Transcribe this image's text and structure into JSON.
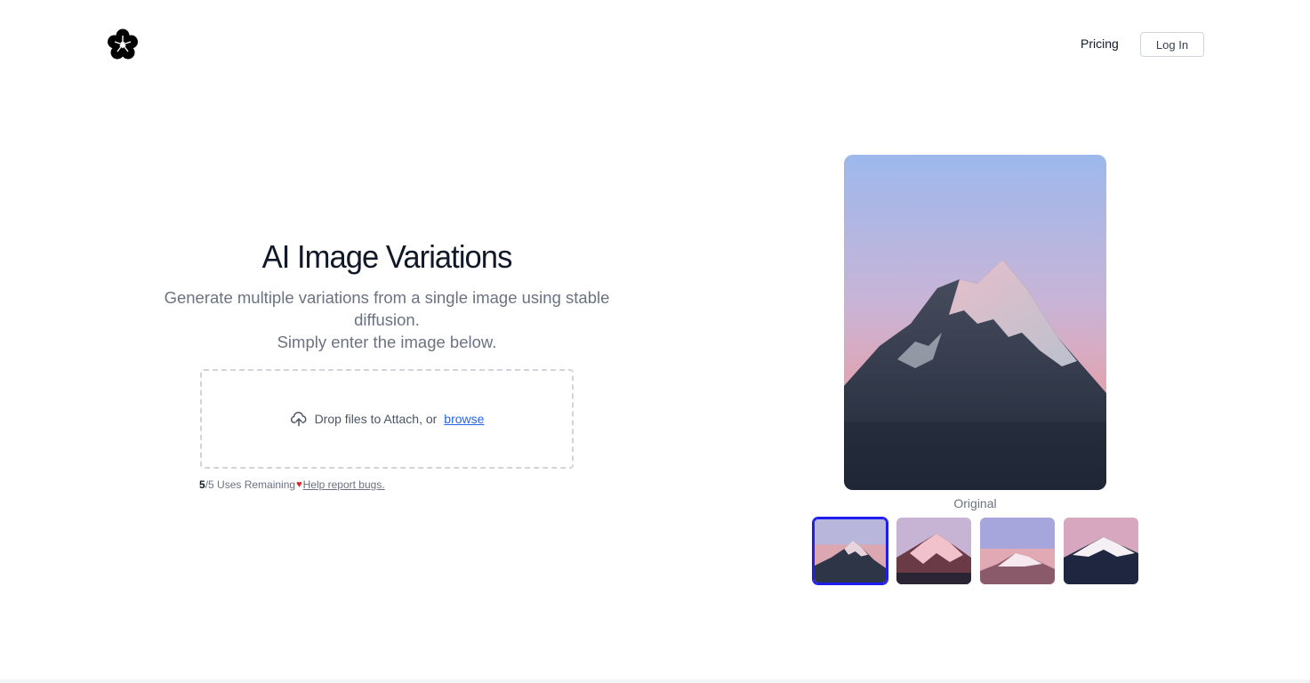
{
  "header": {
    "logo_icon": "flower-logo-icon",
    "pricing_label": "Pricing",
    "login_label": "Log In"
  },
  "hero": {
    "title": "AI Image Variations",
    "subtitle_line1": "Generate multiple variations from a single image using stable diffusion.",
    "subtitle_line2": "Simply enter the image below."
  },
  "upload": {
    "icon": "cloud-upload-icon",
    "prompt": "Drop files to Attach, or",
    "browse_label": "browse"
  },
  "usage": {
    "remaining": "5",
    "total_text": "/5 Uses Remaining",
    "heart_icon": "heart-icon",
    "report_label": "Help report bugs."
  },
  "preview": {
    "caption": "Original",
    "thumbnails": [
      {
        "label": "original",
        "selected": true
      },
      {
        "label": "variation-1",
        "selected": false
      },
      {
        "label": "variation-2",
        "selected": false
      },
      {
        "label": "variation-3",
        "selected": false
      }
    ]
  },
  "colors": {
    "accent": "#1d1df0",
    "link": "#2563eb",
    "heart": "#dc2626",
    "sky_top": "#9db8ec",
    "sky_bottom": "#e7a0a8",
    "mountain_dark": "#2c3446"
  }
}
